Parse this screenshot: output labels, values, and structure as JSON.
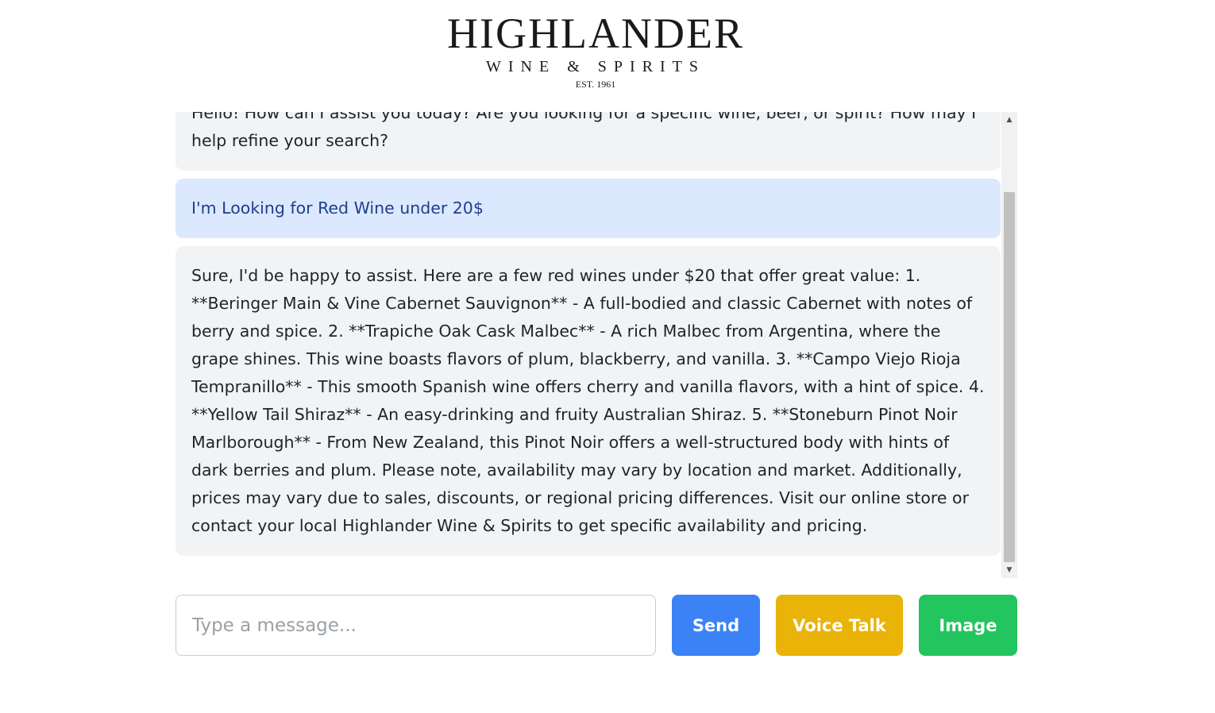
{
  "brand": {
    "name": "HIGHLANDER",
    "subtitle": "WINE & SPIRITS",
    "established": "EST. 1961"
  },
  "messages": [
    {
      "role": "bot",
      "text": "Hello! How can I assist you today? Are you looking for a specific wine, beer, or spirit? How may I help refine your search?"
    },
    {
      "role": "user",
      "text": "I'm Looking for Red Wine under 20$"
    },
    {
      "role": "bot",
      "text": "Sure, I'd be happy to assist. Here are a few red wines under $20 that offer great value: 1. **Beringer Main & Vine Cabernet Sauvignon** - A full-bodied and classic Cabernet with notes of berry and spice. 2. **Trapiche Oak Cask Malbec** - A rich Malbec from Argentina, where the grape shines. This wine boasts flavors of plum, blackberry, and vanilla. 3. **Campo Viejo Rioja Tempranillo** - This smooth Spanish wine offers cherry and vanilla flavors, with a hint of spice. 4. **Yellow Tail Shiraz** - An easy-drinking and fruity Australian Shiraz. 5. **Stoneburn Pinot Noir Marlborough** - From New Zealand, this Pinot Noir offers a well-structured body with hints of dark berries and plum. Please note, availability may vary by location and market. Additionally, prices may vary due to sales, discounts, or regional pricing differences. Visit our online store or contact your local Highlander Wine & Spirits to get specific availability and pricing."
    }
  ],
  "composer": {
    "placeholder": "Type a message...",
    "value": ""
  },
  "buttons": {
    "send": "Send",
    "voice": "Voice Talk",
    "image": "Image"
  },
  "colors": {
    "send": "#3b82f6",
    "voice": "#eab308",
    "image": "#22c55e",
    "bot_bubble": "#f2f3f5",
    "user_bubble": "#dbe8fd",
    "user_text": "#1e3f8a"
  }
}
